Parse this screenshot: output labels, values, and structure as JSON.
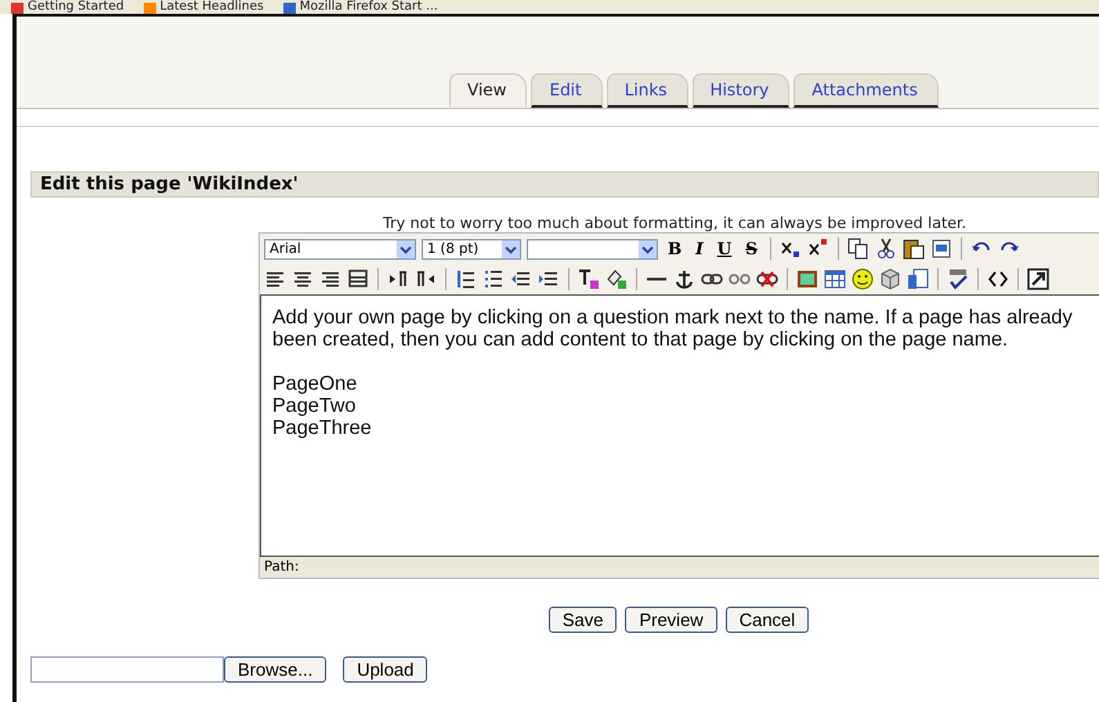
{
  "bookmarks": [
    {
      "label": "Getting Started"
    },
    {
      "label": "Latest Headlines"
    },
    {
      "label": "Mozilla Firefox Start ..."
    }
  ],
  "tabs": [
    {
      "label": "View",
      "selected": true
    },
    {
      "label": "Edit",
      "selected": false
    },
    {
      "label": "Links",
      "selected": false
    },
    {
      "label": "History",
      "selected": false
    },
    {
      "label": "Attachments",
      "selected": false
    }
  ],
  "section_title": "Edit this page 'WikiIndex'",
  "hint": "Try not to worry too much about formatting, it can always be improved later.",
  "editor": {
    "font_select": "Arial",
    "size_select": "1 (8 pt)",
    "style_buttons": [
      "B",
      "I",
      "U",
      "S"
    ],
    "paragraphs": [
      "Add your own page by clicking on a question mark next to the name. If a page has already been created, then you can add content to that page by clicking on the page name."
    ],
    "lines": [
      "PageOne",
      "PageTwo",
      "PageThree"
    ],
    "path_label": "Path:"
  },
  "buttons": [
    "Save",
    "Preview",
    "Cancel"
  ],
  "upload": {
    "browse": "Browse...",
    "upload": "Upload"
  }
}
